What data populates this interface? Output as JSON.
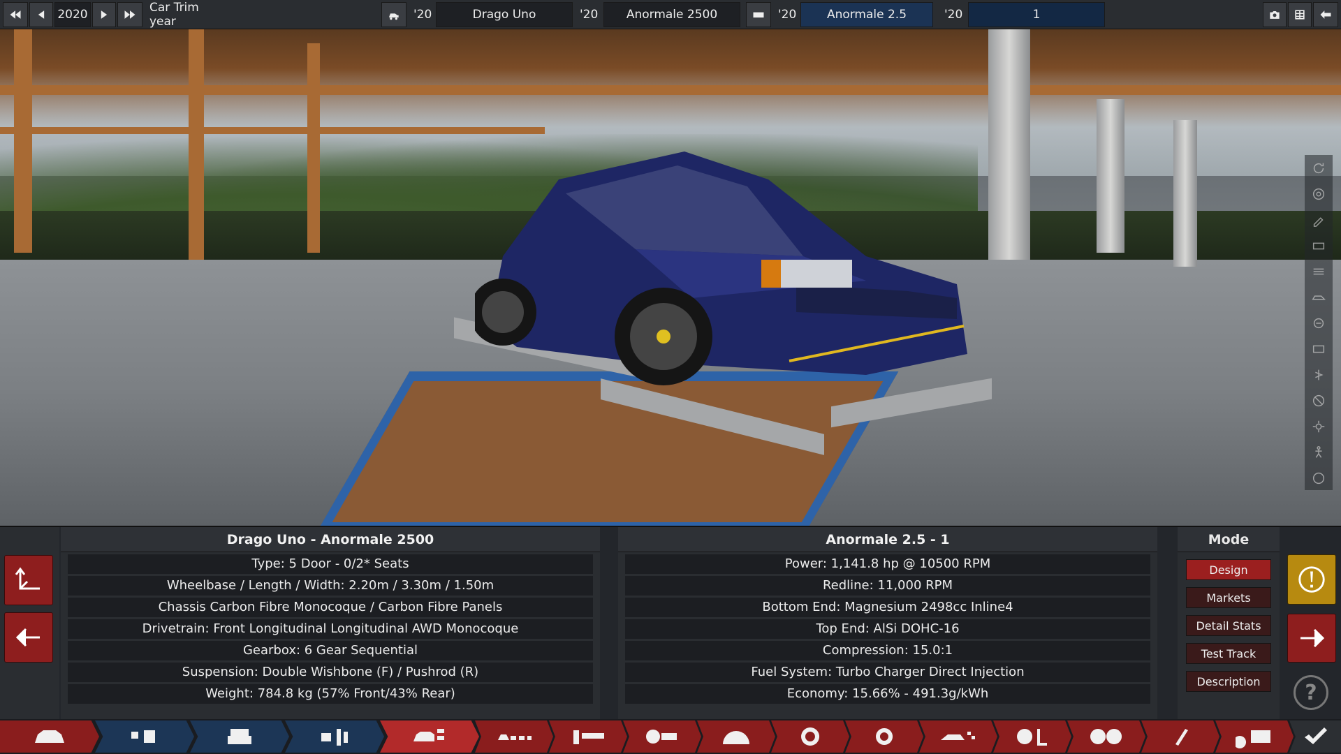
{
  "topbar": {
    "year": "2020",
    "trim_label": "Car Trim year",
    "model_year": "'20",
    "model_name": "Drago Uno",
    "trim_year": "'20",
    "trim_name": "Anormale 2500",
    "engine_year": "'20",
    "engine_name": "Anormale 2.5",
    "variant_year": "'20",
    "variant_name": "1"
  },
  "car_info": {
    "title": "Drago Uno - Anormale 2500",
    "rows": [
      "Type: 5 Door - 0/2* Seats",
      "Wheelbase / Length / Width: 2.20m / 3.30m / 1.50m",
      "Chassis Carbon Fibre Monocoque / Carbon Fibre Panels",
      "Drivetrain: Front Longitudinal Longitudinal AWD Monocoque",
      "Gearbox: 6 Gear Sequential",
      "Suspension: Double Wishbone (F) / Pushrod (R)",
      "Weight: 784.8 kg (57% Front/43% Rear)"
    ]
  },
  "engine_info": {
    "title": "Anormale 2.5 - 1",
    "rows": [
      "Power: 1,141.8 hp @ 10500 RPM",
      "Redline:  11,000 RPM",
      "Bottom End: Magnesium 2498cc Inline4",
      "Top End: AlSi DOHC-16",
      "Compression: 15.0:1",
      "Fuel System: Turbo Charger Direct Injection",
      "Economy: 15.66% - 491.3g/kWh"
    ]
  },
  "mode": {
    "title": "Mode",
    "buttons": [
      "Design",
      "Markets",
      "Detail Stats",
      "Test Track",
      "Description"
    ],
    "active": "Design"
  },
  "help_glyph": "?",
  "colors": {
    "accent_red": "#8e1e1e",
    "active_red": "#9b1f1f",
    "accent_blue": "#1b3354",
    "warning_yellow": "#b78a10"
  },
  "icons": {
    "topbar": [
      "first-icon",
      "prev-icon",
      "next-icon",
      "last-icon",
      "car-model-icon",
      "engine-icon",
      "camera-icon",
      "spreadsheet-icon",
      "back-icon"
    ],
    "bottomnav": [
      "car-body-icon",
      "engine-parts-icon",
      "engine-block-icon",
      "engine-tune-icon",
      "car-design-icon",
      "chassis-icon",
      "suspension-icon",
      "drivetrain-icon",
      "gearbox-icon",
      "wheels-icon",
      "brakes-icon",
      "aero-icon",
      "interior-icon",
      "safety-icon",
      "paint-icon",
      "testing-icon",
      "finish-icon"
    ]
  }
}
